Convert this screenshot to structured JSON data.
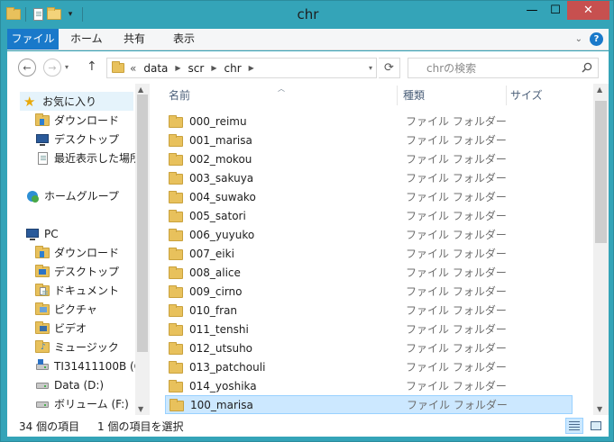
{
  "window": {
    "title": "chr",
    "close_label": "✕",
    "min_label": "—",
    "max_label": "☐"
  },
  "ribbon": {
    "tabs": [
      "ファイル",
      "ホーム",
      "共有",
      "表示"
    ],
    "help_label": "?",
    "expand_label": "⌄"
  },
  "address": {
    "prefix": "«",
    "crumbs": [
      "data",
      "scr",
      "chr"
    ],
    "search_placeholder": "chrの検索"
  },
  "nav_pane": {
    "items": [
      {
        "label": "お気に入り",
        "icon": "star-icon"
      },
      {
        "label": "ダウンロード",
        "icon": "download-folder-icon"
      },
      {
        "label": "デスクトップ",
        "icon": "desktop-icon"
      },
      {
        "label": "最近表示した場所",
        "icon": "recent-places-icon"
      },
      {
        "label": "ホームグループ",
        "icon": "homegroup-icon"
      },
      {
        "label": "PC",
        "icon": "pc-icon"
      },
      {
        "label": "ダウンロード",
        "icon": "download-folder-icon"
      },
      {
        "label": "デスクトップ",
        "icon": "desktop-folder-icon"
      },
      {
        "label": "ドキュメント",
        "icon": "documents-folder-icon"
      },
      {
        "label": "ピクチャ",
        "icon": "pictures-folder-icon"
      },
      {
        "label": "ビデオ",
        "icon": "videos-folder-icon"
      },
      {
        "label": "ミュージック",
        "icon": "music-folder-icon"
      },
      {
        "label": "TI31411100B (C",
        "icon": "system-drive-icon"
      },
      {
        "label": "Data (D:)",
        "icon": "drive-icon"
      },
      {
        "label": "ボリューム (F:)",
        "icon": "drive-icon"
      }
    ]
  },
  "columns": {
    "name": "名前",
    "type": "種類",
    "size": "サイズ"
  },
  "files": [
    {
      "name": "000_reimu",
      "type": "ファイル フォルダー"
    },
    {
      "name": "001_marisa",
      "type": "ファイル フォルダー"
    },
    {
      "name": "002_mokou",
      "type": "ファイル フォルダー"
    },
    {
      "name": "003_sakuya",
      "type": "ファイル フォルダー"
    },
    {
      "name": "004_suwako",
      "type": "ファイル フォルダー"
    },
    {
      "name": "005_satori",
      "type": "ファイル フォルダー"
    },
    {
      "name": "006_yuyuko",
      "type": "ファイル フォルダー"
    },
    {
      "name": "007_eiki",
      "type": "ファイル フォルダー"
    },
    {
      "name": "008_alice",
      "type": "ファイル フォルダー"
    },
    {
      "name": "009_cirno",
      "type": "ファイル フォルダー"
    },
    {
      "name": "010_fran",
      "type": "ファイル フォルダー"
    },
    {
      "name": "011_tenshi",
      "type": "ファイル フォルダー"
    },
    {
      "name": "012_utsuho",
      "type": "ファイル フォルダー"
    },
    {
      "name": "013_patchouli",
      "type": "ファイル フォルダー"
    },
    {
      "name": "014_yoshika",
      "type": "ファイル フォルダー"
    },
    {
      "name": "100_marisa",
      "type": "ファイル フォルダー",
      "selected": true
    }
  ],
  "status": {
    "count": "34 個の項目",
    "selection": "1 個の項目を選択"
  },
  "colors": {
    "frame": "#34a4b8",
    "accent": "#1979ca",
    "selection": "#cce8ff",
    "folder": "#e8c15c"
  }
}
